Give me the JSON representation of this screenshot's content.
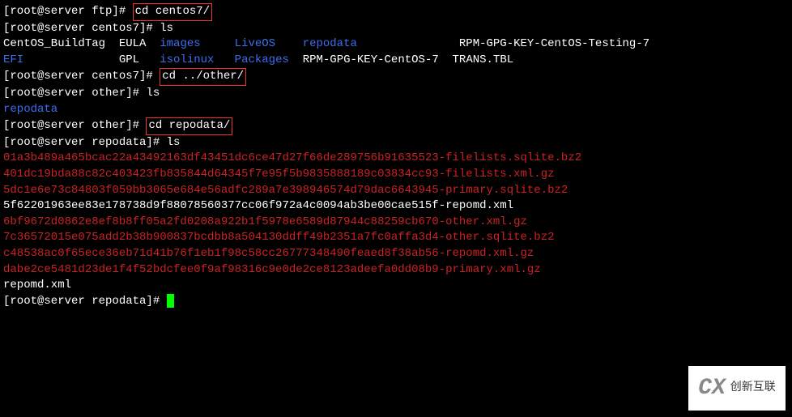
{
  "lines": [
    {
      "parts": [
        {
          "cls": "prompt",
          "t": "[root@server ftp]# "
        },
        {
          "cls": "cmd boxed",
          "t": "cd centos7/"
        }
      ]
    },
    {
      "parts": [
        {
          "cls": "prompt",
          "t": "[root@server centos7]# "
        },
        {
          "cls": "cmd",
          "t": "ls"
        }
      ]
    },
    {
      "parts": [
        {
          "cls": "white",
          "t": "CentOS_BuildTag  EULA  "
        },
        {
          "cls": "blue",
          "t": "images     LiveOS    repodata"
        },
        {
          "cls": "white",
          "t": "               RPM-GPG-KEY-CentOS-Testing-7"
        }
      ]
    },
    {
      "parts": [
        {
          "cls": "blue",
          "t": "EFI"
        },
        {
          "cls": "white",
          "t": "              GPL   "
        },
        {
          "cls": "blue",
          "t": "isolinux   Packages"
        },
        {
          "cls": "white",
          "t": "  RPM-GPG-KEY-CentOS-7  TRANS.TBL"
        }
      ]
    },
    {
      "parts": [
        {
          "cls": "prompt",
          "t": "[root@server centos7]# "
        },
        {
          "cls": "cmd boxed",
          "t": "cd ../other/"
        }
      ]
    },
    {
      "parts": [
        {
          "cls": "prompt",
          "t": "[root@server other]# "
        },
        {
          "cls": "cmd",
          "t": "ls"
        }
      ]
    },
    {
      "parts": [
        {
          "cls": "blue",
          "t": "repodata"
        }
      ]
    },
    {
      "parts": [
        {
          "cls": "prompt",
          "t": "[root@server other]# "
        },
        {
          "cls": "cmd boxed",
          "t": "cd repodata/"
        }
      ]
    },
    {
      "parts": [
        {
          "cls": "prompt",
          "t": "[root@server repodata]# "
        },
        {
          "cls": "cmd",
          "t": "ls"
        }
      ]
    },
    {
      "parts": [
        {
          "cls": "red",
          "t": "01a3b489a465bcac22a43492163df43451dc6ce47d27f66de289756b91635523-filelists.sqlite.bz2"
        }
      ]
    },
    {
      "parts": [
        {
          "cls": "red",
          "t": "401dc19bda88c82c403423fb835844d64345f7e95f5b9835888189c03834cc93-filelists.xml.gz"
        }
      ]
    },
    {
      "parts": [
        {
          "cls": "red",
          "t": "5dc1e6e73c84803f059bb3065e684e56adfc289a7e398946574d79dac6643945-primary.sqlite.bz2"
        }
      ]
    },
    {
      "parts": [
        {
          "cls": "white",
          "t": "5f62201963ee83e178738d9f88078560377cc06f972a4c0094ab3be00cae515f-repomd.xml"
        }
      ]
    },
    {
      "parts": [
        {
          "cls": "red",
          "t": "6bf9672d0862e8ef8b8ff05a2fd0208a922b1f5978e6589d87944c88259cb670-other.xml.gz"
        }
      ]
    },
    {
      "parts": [
        {
          "cls": "red",
          "t": "7c36572015e075add2b38b900837bcdbb8a504130ddff49b2351a7fc0affa3d4-other.sqlite.bz2"
        }
      ]
    },
    {
      "parts": [
        {
          "cls": "red",
          "t": "c48538ac0f65ece36eb71d41b76f1eb1f98c58cc26777348490feaed8f38ab56-repomd.xml.gz"
        }
      ]
    },
    {
      "parts": [
        {
          "cls": "red",
          "t": "dabe2ce5481d23de1f4f52bdcfee0f9af98316c9e0de2ce8123adeefa0dd08b9-primary.xml.gz"
        }
      ]
    },
    {
      "parts": [
        {
          "cls": "white",
          "t": "repomd.xml"
        }
      ]
    },
    {
      "parts": [
        {
          "cls": "prompt",
          "t": "[root@server repodata]# "
        },
        {
          "cls": "cursor",
          "t": ""
        }
      ]
    }
  ],
  "watermark": {
    "icon": "CX",
    "text": "创新互联"
  }
}
